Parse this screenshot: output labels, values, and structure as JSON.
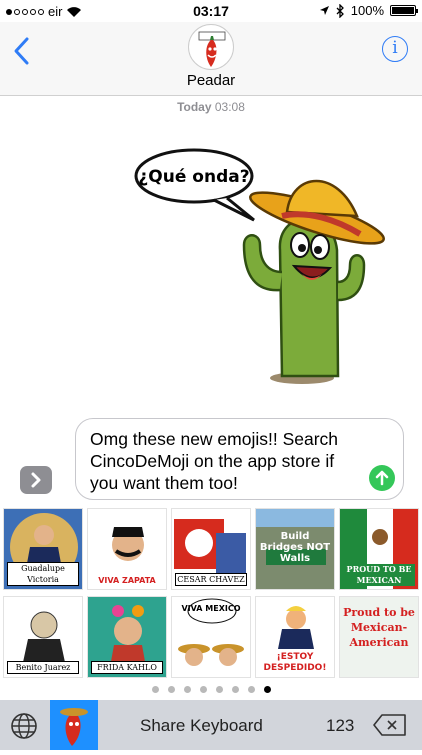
{
  "status_bar": {
    "carrier": "eir",
    "time": "03:17",
    "battery": "100%"
  },
  "header": {
    "contact_name": "Peadar",
    "info_symbol": "i"
  },
  "conversation": {
    "timestamp_day": "Today",
    "timestamp_time": "03:08",
    "sticker_text": "¿Qué onda?",
    "message_text": "Omg these new emojis!! Search CincoDeMoji on the app store if you want them too!"
  },
  "stickers": [
    {
      "caption": "Guadalupe Victoria"
    },
    {
      "caption": "VIVA ZAPATA"
    },
    {
      "caption": "CESAR CHAVEZ"
    },
    {
      "caption": "Build Bridges NOT Walls"
    },
    {
      "caption": "PROUD TO BE MEXICAN"
    },
    {
      "caption": "Benito Juarez"
    },
    {
      "caption": "FRIDA KAHLO"
    },
    {
      "caption": "VIVA MEXICO"
    },
    {
      "caption": "¡ESTOY DESPEDIDO!"
    },
    {
      "caption": "Proud to be Mexican-American"
    }
  ],
  "pager": {
    "pages": 8,
    "active": 8
  },
  "keyboard_bar": {
    "share_label": "Share Keyboard",
    "numbers_label": "123"
  },
  "colors": {
    "accent": "#2f7cf6",
    "send": "#34c759",
    "bar": "#d2d5db"
  }
}
